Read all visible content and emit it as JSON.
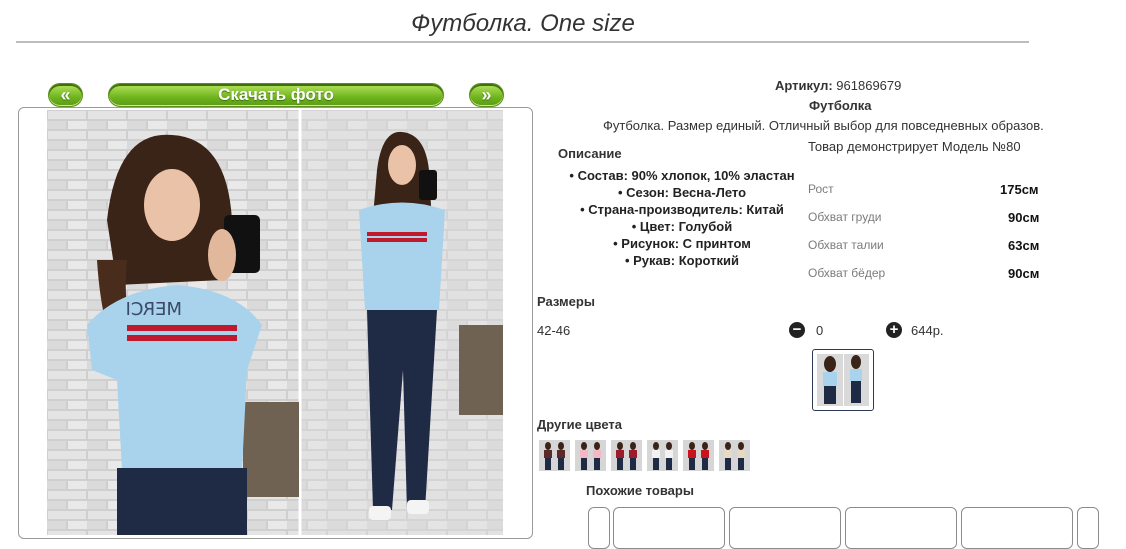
{
  "page": {
    "title": "Футболка. One size"
  },
  "gallery": {
    "prev_label": "«",
    "next_label": "»",
    "download_label": "Скачать фото"
  },
  "product": {
    "article_label": "Артикул:",
    "article_value": "961869679",
    "name": "Футболка",
    "summary": "Футболка. Размер единый. Отличный выбор для повседневных образов.",
    "model_text": "Товар демонстрирует Модель №80"
  },
  "description": {
    "heading": "Описание",
    "items": [
      "Состав: 90% хлопок, 10% эластан",
      "Сезон: Весна-Лето",
      "Страна-производитель: Китай",
      "Цвет: Голубой",
      "Рисунок: С принтом",
      "Рукав: Короткий"
    ]
  },
  "measurements": [
    {
      "label": "Рост",
      "value": "175см"
    },
    {
      "label": "Обхват груди",
      "value": "90см"
    },
    {
      "label": "Обхват талии",
      "value": "63см"
    },
    {
      "label": "Обхват бёдер",
      "value": "90см"
    }
  ],
  "sizes": {
    "heading": "Размеры",
    "row": {
      "size": "42-46",
      "quantity": "0",
      "price": "644р."
    }
  },
  "other_colors": {
    "heading": "Другие цвета",
    "shirt_colors": [
      "#5a2a2a",
      "#f4b7c4",
      "#9b1c2a",
      "#f2f2f2",
      "#c8141c",
      "#e8d9c2"
    ]
  },
  "similar": {
    "heading": "Похожие товары"
  },
  "colors": {
    "accent_green": "#6fb51e",
    "shirt_blue": "#a9d3ec",
    "jeans": "#1f2a44"
  }
}
